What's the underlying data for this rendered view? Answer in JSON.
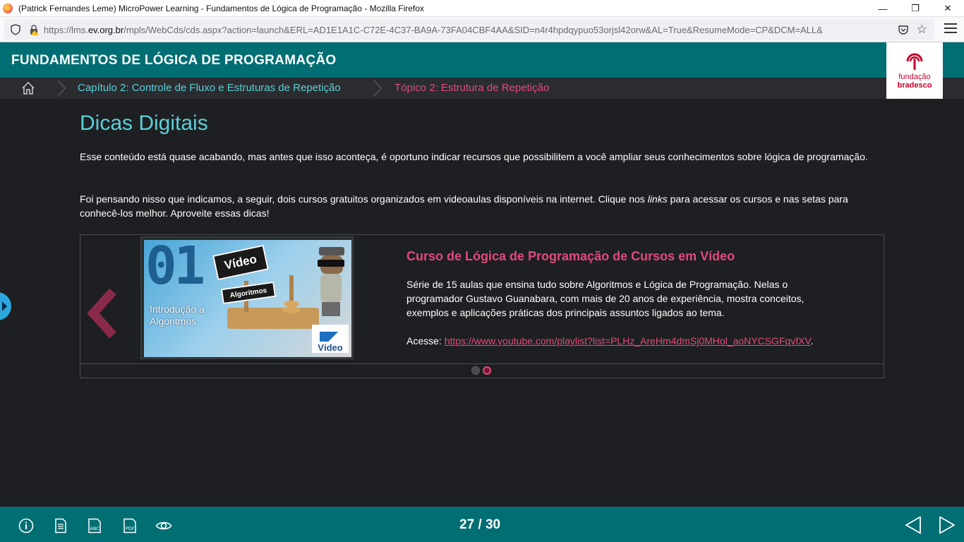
{
  "browser": {
    "window_title": "(Patrick Fernandes Leme) MicroPower Learning - Fundamentos de Lógica de Programação - Mozilla Firefox",
    "url_prefix": "https://lms.",
    "url_domain": "ev.org.br",
    "url_rest": "/mpls/WebCds/cds.aspx?action=launch&ERL=AD1E1A1C-C72E-4C37-BA9A-73FA04CBF4AA&SID=n4r4hpdqypuo53orjsl42orw&AL=True&ResumeMode=CP&DCM=ALL&",
    "minimize": "—",
    "restore": "❐",
    "close": "✕",
    "star": "☆"
  },
  "header": {
    "title": "FUNDAMENTOS DE LÓGICA DE PROGRAMAÇÃO",
    "logo_line1": "fundação",
    "logo_line2": "bradesco"
  },
  "breadcrumb": {
    "chapter": "Capítulo 2: Controle de Fluxo e Estruturas de Repetição",
    "topic": "Tópico 2: Estrutura de Repetição"
  },
  "main": {
    "heading": "Dicas Digitais",
    "paragraph1": "Esse conteúdo está quase acabando, mas antes que isso aconteça, é oportuno indicar recursos que possibilitem a você ampliar seus conhecimentos sobre lógica de programação.",
    "paragraph2_before": "Foi pensando nisso que indicamos, a seguir, dois cursos gratuitos organizados em videoaulas disponíveis na internet. Clique nos ",
    "paragraph2_em": "links",
    "paragraph2_after": " para acessar os cursos e nas setas para conhecê-los melhor. Aproveite essas dicas!"
  },
  "carousel": {
    "thumb_number": "01",
    "thumb_video_label": "Vídeo",
    "thumb_algorithms_label": "Algoritmos",
    "thumb_caption_line1": "Introdução a",
    "thumb_caption_line2": "Algoritmos",
    "thumb_logo_text": "Vídeo",
    "card_title": "Curso de Lógica de Programação de Cursos em Vídeo",
    "card_description": "Série de 15 aulas que ensina tudo sobre Algoritmos e Lógica de Programação. Nelas o programador Gustavo Guanabara, com mais de 20 anos de experiência, mostra conceitos, exemplos e aplicações práticas dos principais assuntos ligados ao tema.",
    "access_label": "Acesse: ",
    "link_text": "https://www.youtube.com/playlist?list=PLHz_AreHm4dmSj0MHol_aoNYCSGFqvfXV",
    "link_suffix": ".",
    "total_slides": 2,
    "active_slide": 2
  },
  "footer": {
    "page_counter": "27 / 30"
  },
  "colors": {
    "header_teal": "#006e73",
    "accent_cyan": "#5ad0d8",
    "accent_pink": "#e14a7c",
    "background": "#1e1f22"
  }
}
